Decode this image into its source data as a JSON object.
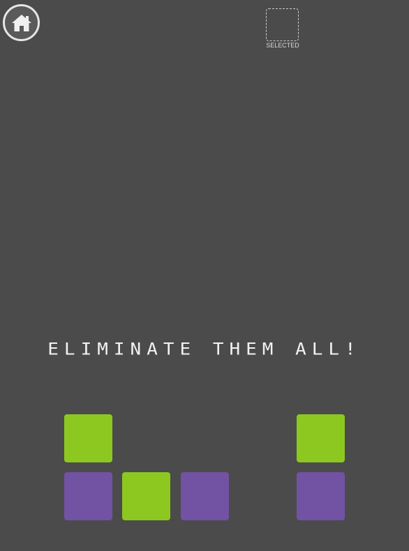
{
  "header": {
    "home_icon": "home-icon",
    "selected_label": "SELECTED"
  },
  "message": "ELIMINATE THEM ALL!",
  "colors": {
    "background": "#4b4b4b",
    "green": "#8cc820",
    "purple": "#7252a3"
  },
  "board": {
    "rows": 2,
    "columns": 5,
    "tiles": [
      {
        "row": 0,
        "col": 0,
        "color": "green"
      },
      {
        "row": 0,
        "col": 4,
        "color": "green"
      },
      {
        "row": 1,
        "col": 0,
        "color": "purple"
      },
      {
        "row": 1,
        "col": 1,
        "color": "green"
      },
      {
        "row": 1,
        "col": 2,
        "color": "purple"
      },
      {
        "row": 1,
        "col": 4,
        "color": "purple"
      }
    ]
  }
}
